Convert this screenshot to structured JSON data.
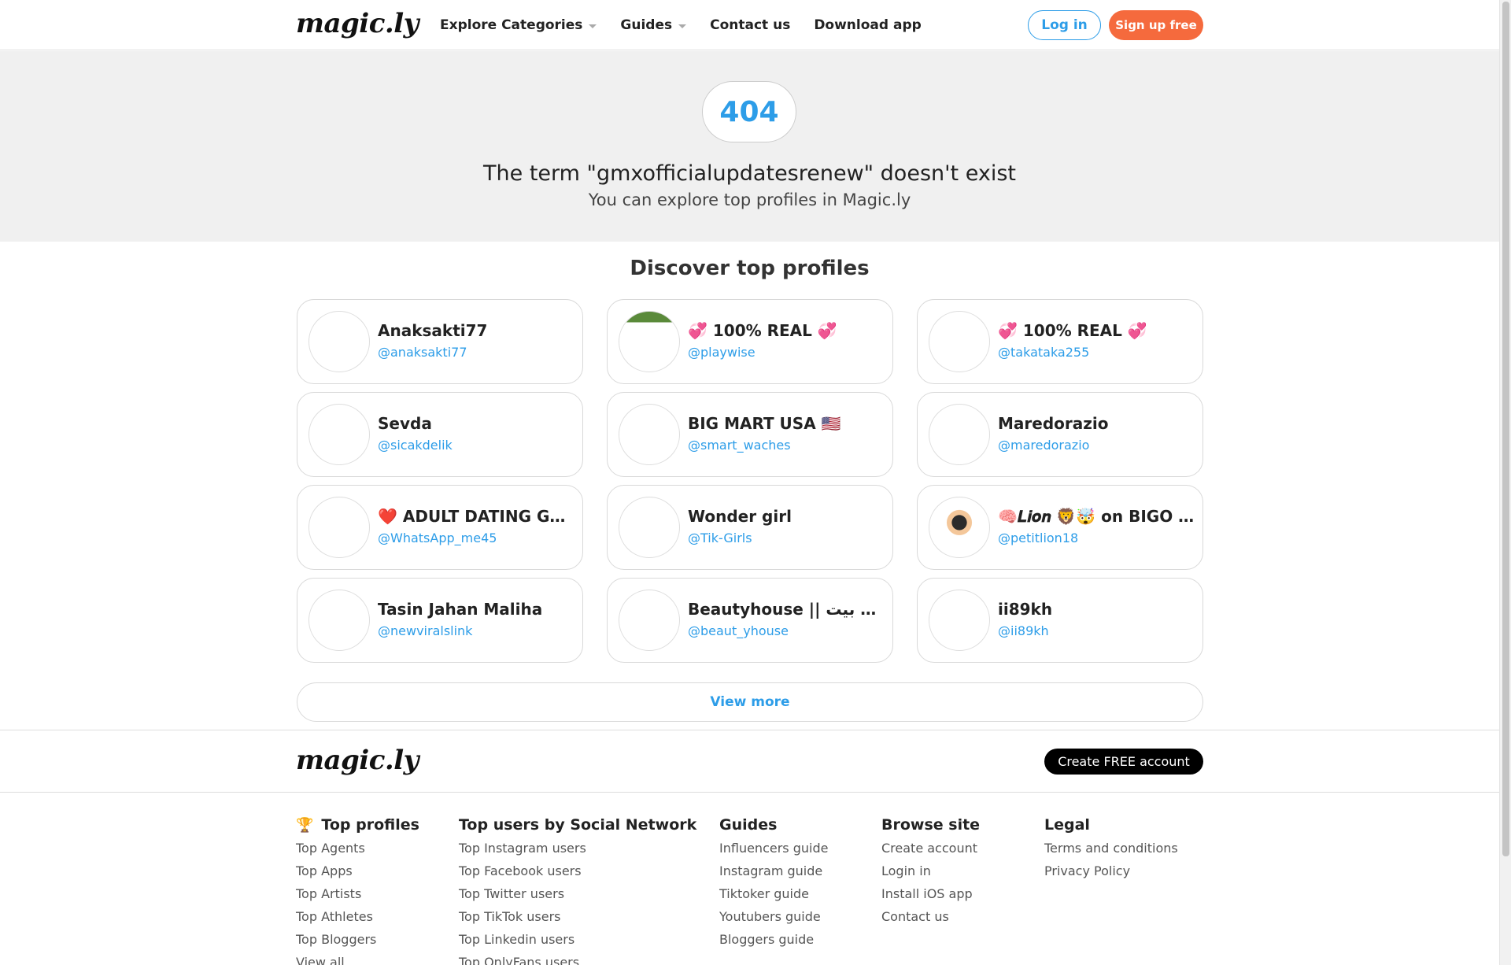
{
  "header": {
    "logo": "magic.ly",
    "nav": [
      {
        "label": "Explore Categories",
        "dropdown": true
      },
      {
        "label": "Guides",
        "dropdown": true
      },
      {
        "label": "Contact us",
        "dropdown": false
      },
      {
        "label": "Download app",
        "dropdown": false
      }
    ],
    "login_label": "Log in",
    "signup_label": "Sign up free"
  },
  "hero": {
    "code": "404",
    "title": "The term \"gmxofficialupdatesrenew\" doesn't exist",
    "subtitle": "You can explore top profiles in Magic.ly"
  },
  "discover": {
    "title": "Discover top profiles",
    "profiles": [
      {
        "name": "Anaksakti77",
        "handle": "@anaksakti77"
      },
      {
        "name": "💞 100% REAL 💞",
        "handle": "@playwise"
      },
      {
        "name": "💞 100% REAL 💞",
        "handle": "@takataka255"
      },
      {
        "name": "Sevda",
        "handle": "@sicakdelik"
      },
      {
        "name": "BIG MART USA 🇺🇸",
        "handle": "@smart_waches"
      },
      {
        "name": "Maredorazio",
        "handle": "@maredorazio"
      },
      {
        "name": "❤️ ADULT DATING GROUP ❤️",
        "handle": "@WhatsApp_me45"
      },
      {
        "name": "Wonder girl",
        "handle": "@Tik-Girls"
      },
      {
        "name": "🧠𝑳𝒊𝒐𝒏 🦁🤯 on BIGO LIVE",
        "handle": "@petitlion18"
      },
      {
        "name": "Tasin Jahan Maliha",
        "handle": "@newviralslink"
      },
      {
        "name": "Beautyhouse || الجمال بيت",
        "handle": "@beaut_yhouse"
      },
      {
        "name": "ii89kh",
        "handle": "@ii89kh"
      }
    ],
    "view_more_label": "View more"
  },
  "footer": {
    "logo": "magic.ly",
    "create_label": "Create FREE account",
    "columns": [
      {
        "title": "Top profiles",
        "items": [
          "Top Agents",
          "Top Apps",
          "Top Artists",
          "Top Athletes",
          "Top Bloggers",
          "View all"
        ]
      },
      {
        "title": "Top users by Social Network",
        "items": [
          "Top Instagram users",
          "Top Facebook users",
          "Top Twitter users",
          "Top TikTok users",
          "Top Linkedin users",
          "Top OnlyFans users"
        ]
      },
      {
        "title": "Guides",
        "items": [
          "Influencers guide",
          "Instagram guide",
          "Tiktoker guide",
          "Youtubers guide",
          "Bloggers guide"
        ]
      },
      {
        "title": "Browse site",
        "items": [
          "Create account",
          "Login in",
          "Install iOS app",
          "Contact us"
        ]
      },
      {
        "title": "Legal",
        "items": [
          "Terms and conditions",
          "Privacy Policy"
        ]
      }
    ]
  },
  "colors": {
    "accent": "#2d9de8",
    "signup": "#f56a3d",
    "hero_bg": "#f0f0f0"
  }
}
